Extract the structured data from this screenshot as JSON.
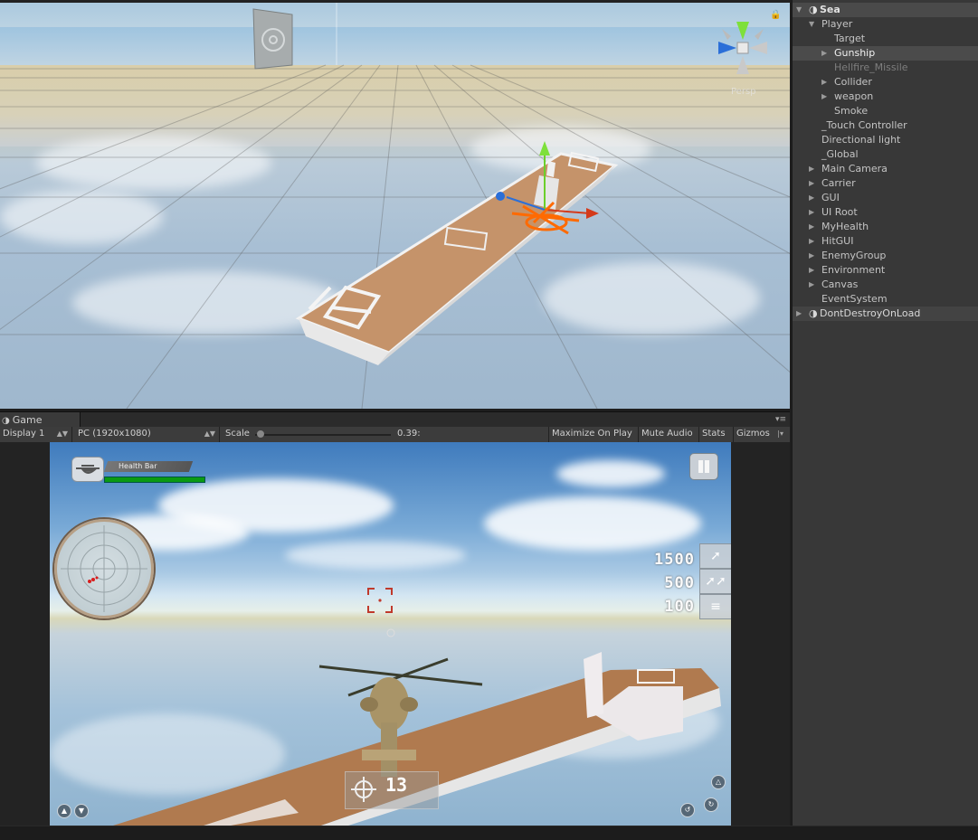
{
  "scene": {
    "persp_label": "Persp"
  },
  "game_tab": {
    "label": "Game"
  },
  "game_toolbar": {
    "display": "Display 1",
    "resolution": "PC (1920x1080)",
    "scale_label": "Scale",
    "scale_value": "0.39:",
    "scale_level": 0.02,
    "maximize_on_play": "Maximize On Play",
    "mute_audio": "Mute Audio",
    "stats": "Stats",
    "gizmos": "Gizmos"
  },
  "game_hud": {
    "health_label": "Health Bar",
    "health_level": 1.0,
    "weapons": [
      {
        "count": "1500",
        "icon": "missile-icon"
      },
      {
        "count": "500",
        "icon": "double-missile-icon"
      },
      {
        "count": "100",
        "icon": "rocket-pod-icon"
      }
    ],
    "ammo_count": "13",
    "colors": {
      "health": "#0a9a13",
      "crosshair": "#c0392b"
    }
  },
  "hierarchy": {
    "items": [
      {
        "label": "Sea",
        "depth": 0,
        "expanded": true,
        "has_children": true,
        "style": "root",
        "icon": "unity-icon"
      },
      {
        "label": "Player",
        "depth": 1,
        "expanded": true,
        "has_children": true
      },
      {
        "label": "Target",
        "depth": 2,
        "has_children": false
      },
      {
        "label": "Gunship",
        "depth": 2,
        "has_children": true,
        "expanded": false,
        "style": "sel-dim"
      },
      {
        "label": "Hellfire_Missile",
        "depth": 2,
        "has_children": false,
        "style": "disabled"
      },
      {
        "label": "Collider",
        "depth": 2,
        "has_children": true,
        "expanded": false
      },
      {
        "label": "weapon",
        "depth": 2,
        "has_children": true,
        "expanded": false
      },
      {
        "label": "Smoke",
        "depth": 2,
        "has_children": false
      },
      {
        "label": "_Touch Controller",
        "depth": 1,
        "has_children": false
      },
      {
        "label": "Directional light",
        "depth": 1,
        "has_children": false
      },
      {
        "label": "_Global",
        "depth": 1,
        "has_children": false
      },
      {
        "label": "Main Camera",
        "depth": 1,
        "has_children": true,
        "expanded": false
      },
      {
        "label": "Carrier",
        "depth": 1,
        "has_children": true,
        "expanded": false
      },
      {
        "label": "GUI",
        "depth": 1,
        "has_children": true,
        "expanded": false
      },
      {
        "label": "UI Root",
        "depth": 1,
        "has_children": true,
        "expanded": false
      },
      {
        "label": "MyHealth",
        "depth": 1,
        "has_children": true,
        "expanded": false
      },
      {
        "label": "HitGUI",
        "depth": 1,
        "has_children": true,
        "expanded": false
      },
      {
        "label": "EnemyGroup",
        "depth": 1,
        "has_children": true,
        "expanded": false
      },
      {
        "label": "Environment",
        "depth": 1,
        "has_children": true,
        "expanded": false
      },
      {
        "label": "Canvas",
        "depth": 1,
        "has_children": true,
        "expanded": false
      },
      {
        "label": "EventSystem",
        "depth": 1,
        "has_children": false
      },
      {
        "label": "DontDestroyOnLoad",
        "depth": 0,
        "has_children": true,
        "expanded": false,
        "style": "root2",
        "icon": "unity-icon"
      }
    ]
  }
}
